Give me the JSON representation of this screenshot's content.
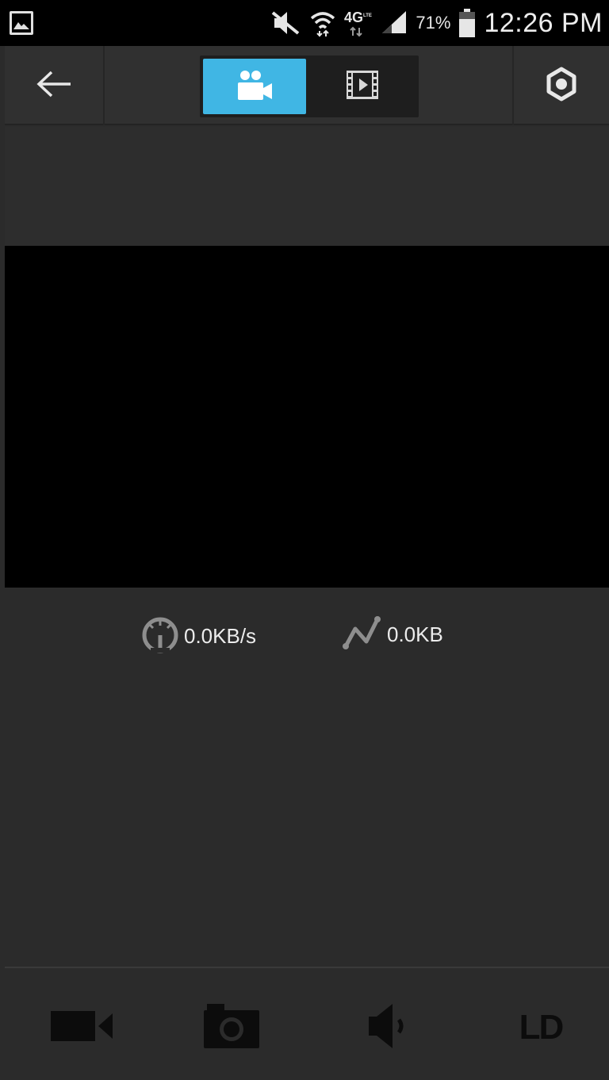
{
  "status_bar": {
    "battery_percent": "71%",
    "time": "12:26 PM",
    "network": "4G LTE",
    "icons": [
      "gallery-icon",
      "mute-icon",
      "wifi-icon",
      "lte-icon",
      "signal-icon",
      "battery-icon"
    ]
  },
  "app_bar": {
    "buttons": [
      "back-arrow-icon",
      "settings-gear-icon"
    ],
    "tabs": [
      {
        "icon": "video-camera-people-icon",
        "selected": true
      },
      {
        "icon": "film-playback-icon",
        "selected": false
      }
    ],
    "accent_color": "#40b6e4"
  },
  "stats": {
    "speed": "0.0KB/s",
    "data": "0.0KB",
    "icons": [
      "speedometer-icon",
      "data-graph-icon"
    ]
  },
  "toolbar": {
    "icons": [
      "record-video-icon",
      "camera-snapshot-icon",
      "speaker-icon"
    ],
    "quality_label": "LD"
  }
}
